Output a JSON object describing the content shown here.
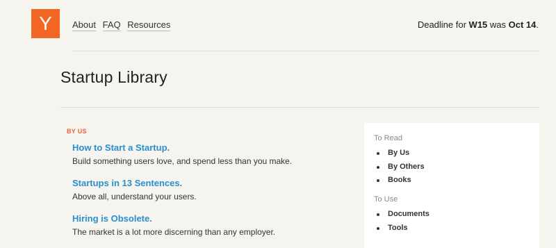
{
  "header": {
    "logo_letter": "Y",
    "nav": [
      {
        "label": "About"
      },
      {
        "label": "FAQ"
      },
      {
        "label": "Resources"
      }
    ],
    "deadline": {
      "prefix": "Deadline for ",
      "batch": "W15",
      "middle": " was ",
      "date": "Oct 14",
      "suffix": "."
    }
  },
  "main": {
    "title": "Startup Library",
    "section_label": "BY US",
    "articles": [
      {
        "title": "How to Start a Startup.",
        "description": "Build something users love, and spend less than you make."
      },
      {
        "title": "Startups in 13 Sentences.",
        "description": "Above all, understand your users."
      },
      {
        "title": "Hiring is Obsolete.",
        "description": "The market is a lot more discerning than any employer."
      }
    ]
  },
  "sidebar": {
    "groups": [
      {
        "heading": "To Read",
        "items": [
          "By Us",
          "By Others",
          "Books"
        ]
      },
      {
        "heading": "To Use",
        "items": [
          "Documents",
          "Tools"
        ]
      }
    ]
  },
  "colors": {
    "accent": "#f26522",
    "link": "#2a8fce",
    "background": "#f5f4ef"
  }
}
